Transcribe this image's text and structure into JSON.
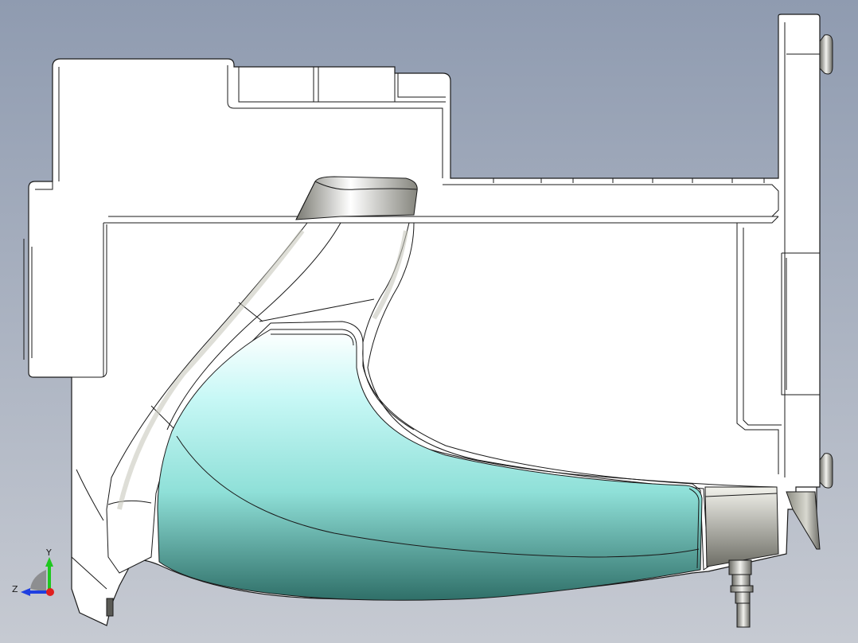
{
  "viewport": {
    "background_top": "#8f9bb0",
    "background_bottom": "#c6cad2"
  },
  "model": {
    "body_color": "#ffffff",
    "edge_color": "#1a1a1a",
    "cavity_color": "#9ff2ee"
  },
  "triad": {
    "y_label": "Y",
    "z_label": "Z",
    "y_color": "#1fc71f",
    "z_color": "#1f3fe0",
    "x_color": "#e01f1f"
  }
}
